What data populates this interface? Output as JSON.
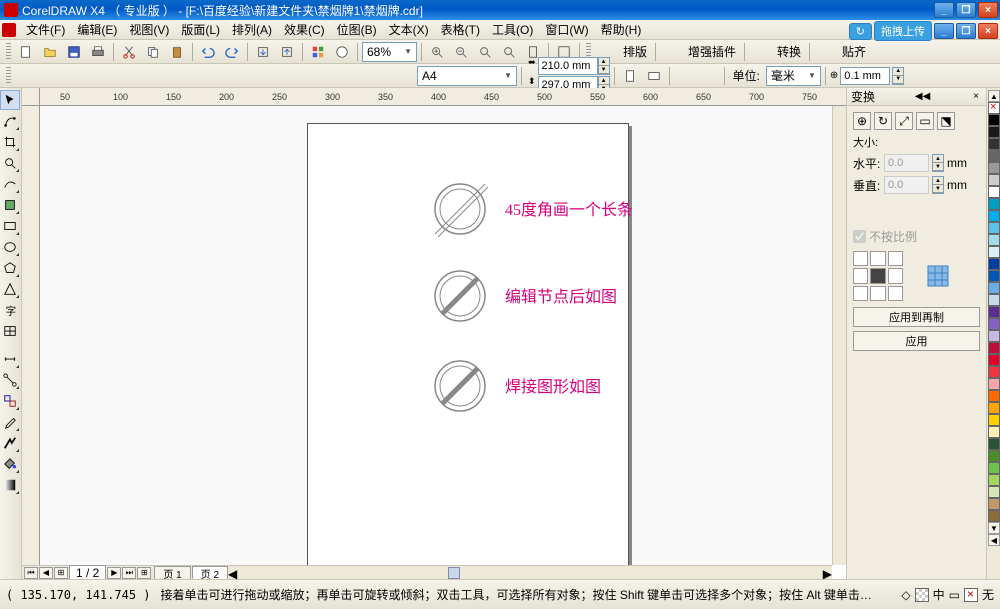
{
  "title": "CorelDRAW X4 （ 专业版 ） - [F:\\百度经验\\新建文件夹\\禁烟牌1\\禁烟牌.cdr]",
  "menus": {
    "file": "文件(F)",
    "edit": "编辑(E)",
    "view": "视图(V)",
    "layout": "版面(L)",
    "arrange": "排列(A)",
    "effects": "效果(C)",
    "bitmaps": "位图(B)",
    "text": "文本(X)",
    "table": "表格(T)",
    "tools": "工具(O)",
    "window": "窗口(W)",
    "help": "帮助(H)"
  },
  "quickfind": "拖拽上传",
  "toolbar": {
    "zoom": "68%",
    "btn_layout": "排版",
    "btn_plugin": "增强插件",
    "btn_transform": "转换",
    "btn_align": "贴齐"
  },
  "propbar": {
    "paper": "A4",
    "width": "210.0 mm",
    "height": "297.0 mm",
    "units_label": "单位:",
    "units": "毫米",
    "nudge": "0.1 mm"
  },
  "ruler_ticks": [
    "50",
    "100",
    "150",
    "200",
    "250",
    "300",
    "350",
    "400",
    "450",
    "500",
    "550",
    "600",
    "650",
    "700",
    "750"
  ],
  "annotations": {
    "a1": "45度角画一个长条",
    "a2": "编辑节点后如图",
    "a3": "焊接图形如图"
  },
  "docker": {
    "title": "变换",
    "size_label": "大小:",
    "h_label": "水平:",
    "v_label": "垂直:",
    "h_val": "0.0",
    "v_val": "0.0",
    "mm": "mm",
    "nonprop": "不按比例",
    "apply_dup": "应用到再制",
    "apply": "应用"
  },
  "pagebar": {
    "counter": "1 / 2",
    "page1": "页 1",
    "page2": "页 2"
  },
  "status": {
    "coords": "( 135.170, 141.745 )",
    "hint": "接着单击可进行拖动或缩放；再单击可旋转或倾斜；双击工具，可选择所有对象；按住 Shift 键单击可选择多个对象；按住 Alt 键单击…",
    "fill_label": "中",
    "stroke_label": "无"
  },
  "palette": [
    "#000000",
    "#1a1a1a",
    "#333333",
    "#666666",
    "#999999",
    "#cccccc",
    "#ffffff",
    "#00a0c6",
    "#00aeef",
    "#5bc2e7",
    "#a3dbe8",
    "#d9f0f6",
    "#003da5",
    "#0057b8",
    "#6cace4",
    "#c8d8eb",
    "#5c2d91",
    "#8661c5",
    "#c7b8e0",
    "#bf0d3e",
    "#e4002b",
    "#ef3340",
    "#f4a6a6",
    "#ff6a00",
    "#ffa300",
    "#ffcd00",
    "#fff1b5",
    "#2c5234",
    "#4c8c2b",
    "#6cc24a",
    "#a4d65e",
    "#d4e8b5",
    "#c19a6b",
    "#8a6d3b"
  ]
}
